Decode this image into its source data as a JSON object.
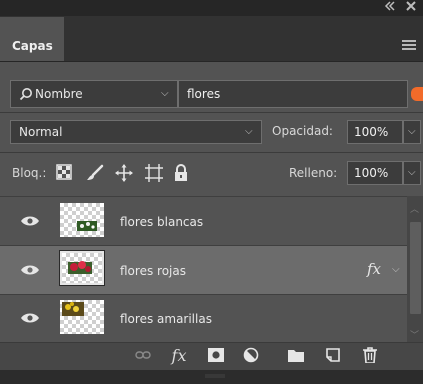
{
  "window": {
    "collapse_icon": "double-chevron-left-icon",
    "close_icon": "close-icon"
  },
  "panel": {
    "tab_label": "Capas",
    "menu_icon": "hamburger-menu-icon"
  },
  "filter": {
    "kind_value": "Nombre",
    "name_value": "flores",
    "toggle_color": "#f26b2a"
  },
  "blend": {
    "mode_value": "Normal",
    "opacity_label": "Opacidad:",
    "opacity_value": "100%"
  },
  "lock": {
    "label": "Bloq.:",
    "icons": [
      "lock-transparent-pixels-icon",
      "lock-image-pixels-icon",
      "lock-position-icon",
      "prevent-autonest-icon",
      "lock-all-icon"
    ],
    "fill_label": "Relleno:",
    "fill_value": "100%"
  },
  "layers": [
    {
      "name": "flores blancas",
      "visible": true,
      "selected": false,
      "has_fx": false
    },
    {
      "name": "flores rojas",
      "visible": true,
      "selected": true,
      "has_fx": true,
      "fx_label": "fx"
    },
    {
      "name": "flores amarillas",
      "visible": true,
      "selected": false,
      "has_fx": false
    }
  ],
  "footer": {
    "fx_label": "fx",
    "icons": [
      "link-layers-icon",
      "layer-style-icon",
      "add-mask-icon",
      "adjustment-layer-icon",
      "new-group-icon",
      "new-layer-icon",
      "trash-icon"
    ]
  },
  "colors": {
    "panel_bg": "#535353",
    "selected_row": "#6c6c6c",
    "accent": "#f26b2a"
  }
}
